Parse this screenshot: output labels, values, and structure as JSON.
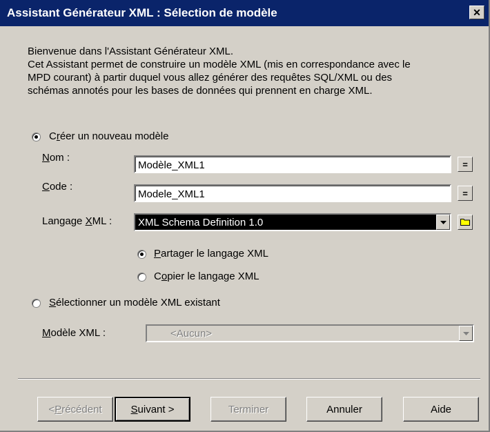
{
  "window": {
    "title": "Assistant Générateur XML : Sélection de modèle",
    "close_label": "✕"
  },
  "intro": {
    "line1": "Bienvenue dans l'Assistant Générateur XML.",
    "line2": "Cet Assistant permet de construire un modèle XML (mis en correspondance avec le",
    "line3": "MPD courant) à partir duquel vous allez générer des requêtes SQL/XML ou des",
    "line4": "schémas annotés pour les bases de données qui prennent en charge XML."
  },
  "create_new": {
    "checked": true,
    "label_prefix": "C",
    "label_u": "r",
    "label_rest": "éer un nouveau modèle",
    "name_label_u": "N",
    "name_label_rest": "om :",
    "name_value": "Modèle_XML1",
    "code_label_u": "C",
    "code_label_rest": "ode :",
    "code_value": "Modele_XML1",
    "lang_label_prefix": "Langage ",
    "lang_label_u": "X",
    "lang_label_rest": "ML :",
    "lang_value": "XML Schema Definition 1.0",
    "share_checked": true,
    "share_label_u": "P",
    "share_label_rest": "artager le langage XML",
    "copy_checked": false,
    "copy_label_prefix": "C",
    "copy_label_u": "o",
    "copy_label_rest": "pier le langage XML"
  },
  "select_existing": {
    "checked": false,
    "label_u": "S",
    "label_rest": "électionner un modèle XML existant",
    "model_label_u": "M",
    "model_label_rest": "odèle XML :",
    "model_value": "<Aucun>"
  },
  "buttons": {
    "prev_prefix": "< ",
    "prev_u": "P",
    "prev_rest": "récédent",
    "next_u": "S",
    "next_rest": "uivant >",
    "finish": "Terminer",
    "cancel": "Annuler",
    "help": "Aide"
  },
  "colors": {
    "titlebar": "#0a246a",
    "selection": "#000000",
    "folder": "#ffff00"
  }
}
